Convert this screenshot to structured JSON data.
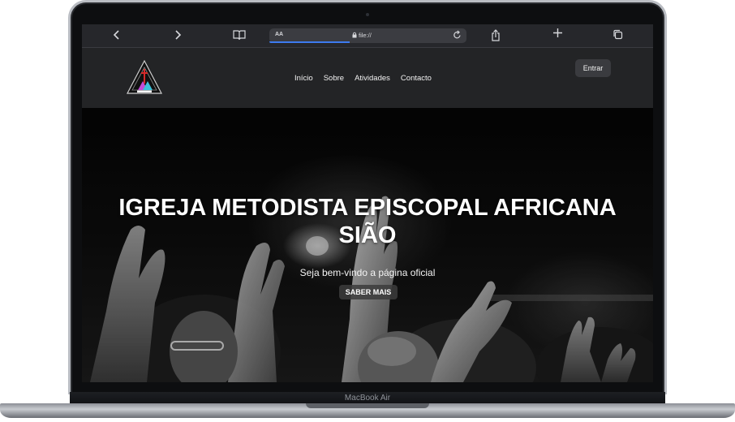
{
  "device": {
    "model_label": "MacBook Air"
  },
  "browser": {
    "aa_label": "AA",
    "url": "file://",
    "icons": [
      "chevron-left-icon",
      "chevron-right-icon",
      "book-icon",
      "lock-icon",
      "reload-icon",
      "share-icon",
      "plus-icon",
      "tabs-icon"
    ]
  },
  "site": {
    "nav": [
      {
        "label": "Início"
      },
      {
        "label": "Sobre"
      },
      {
        "label": "Atividades"
      },
      {
        "label": "Contacto"
      }
    ],
    "login_label": "Entrar",
    "hero": {
      "title_line1": "IGREJA METODISTA EPISCOPAL AFRICANA",
      "title_line2": "SIÃO",
      "subtitle": "Seja bem-vindo a página oficial",
      "cta_label": "SABER MAIS"
    }
  },
  "colors": {
    "accent_blue": "#3d7bf0",
    "header_bg": "#242528",
    "text": "#ffffff"
  }
}
